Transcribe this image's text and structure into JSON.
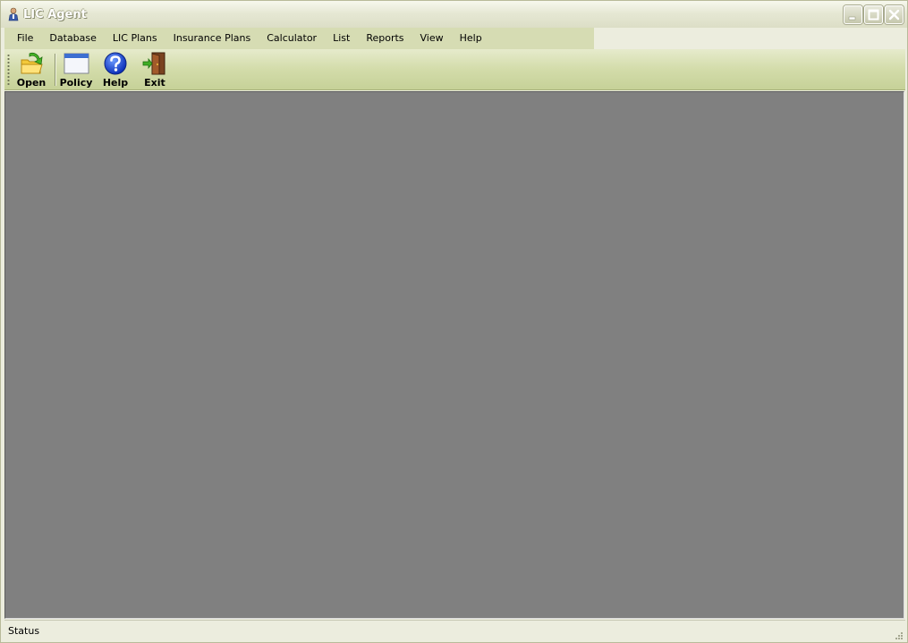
{
  "window": {
    "title": "LIC Agent",
    "title_icon": "person-icon"
  },
  "menu": {
    "items": [
      {
        "label": "File"
      },
      {
        "label": "Database"
      },
      {
        "label": "LIC Plans"
      },
      {
        "label": "Insurance Plans"
      },
      {
        "label": "Calculator"
      },
      {
        "label": "List"
      },
      {
        "label": "Reports"
      },
      {
        "label": "View"
      },
      {
        "label": "Help"
      }
    ]
  },
  "toolbar": {
    "buttons": [
      {
        "label": "Open",
        "icon": "open-folder-arrow-icon"
      },
      {
        "label": "Policy",
        "icon": "window-form-icon"
      },
      {
        "label": "Help",
        "icon": "question-mark-icon"
      },
      {
        "label": "Exit",
        "icon": "exit-door-icon"
      }
    ]
  },
  "statusbar": {
    "text": "Status"
  },
  "colors": {
    "menubar_bg": "#d6dcb3",
    "toolbar_bg": "#d3dcaa",
    "client_bg": "#808080",
    "frame_bg": "#ecedde"
  }
}
